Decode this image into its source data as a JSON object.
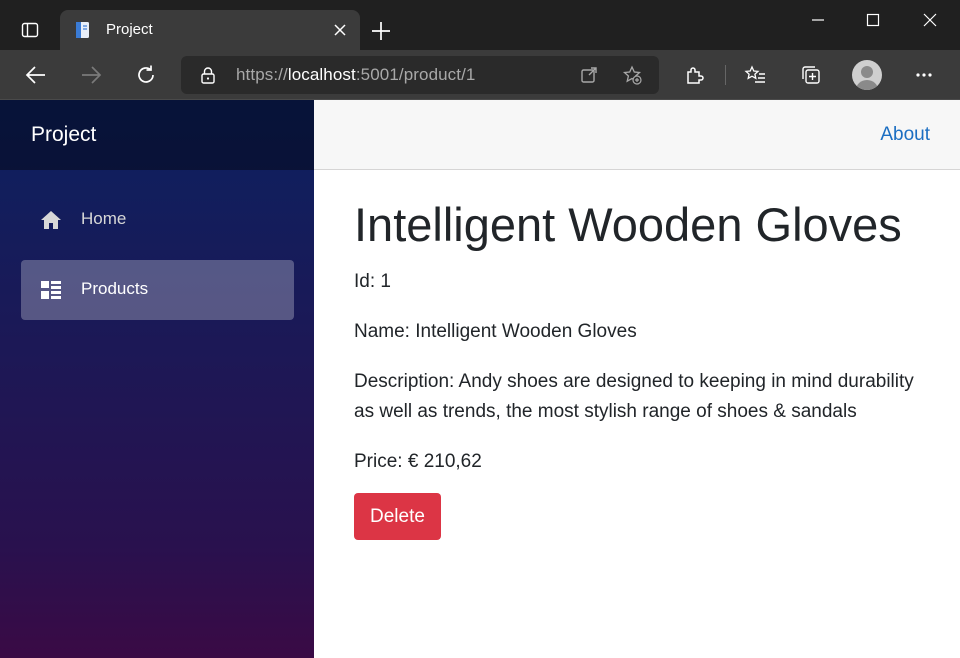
{
  "browser": {
    "tab_title": "Project",
    "url_scheme": "https://",
    "url_host": "localhost",
    "url_path": ":5001/product/1"
  },
  "app": {
    "brand": "Project",
    "top_link": "About",
    "nav": [
      {
        "label": "Home",
        "icon": "home-icon",
        "active": false
      },
      {
        "label": "Products",
        "icon": "list-icon",
        "active": true
      }
    ]
  },
  "product": {
    "title": "Intelligent Wooden Gloves",
    "id_line": "Id: 1",
    "name_line": "Name: Intelligent Wooden Gloves",
    "description_line": "Description: Andy shoes are designed to keeping in mind durability as well as trends, the most stylish range of shoes & sandals",
    "price_line": "Price: € 210,62",
    "delete_label": "Delete"
  },
  "colors": {
    "accent_link": "#1b6ec2",
    "danger": "#dc3545",
    "sidebar_top": "#0c2160",
    "sidebar_bottom": "#3a0a45"
  }
}
